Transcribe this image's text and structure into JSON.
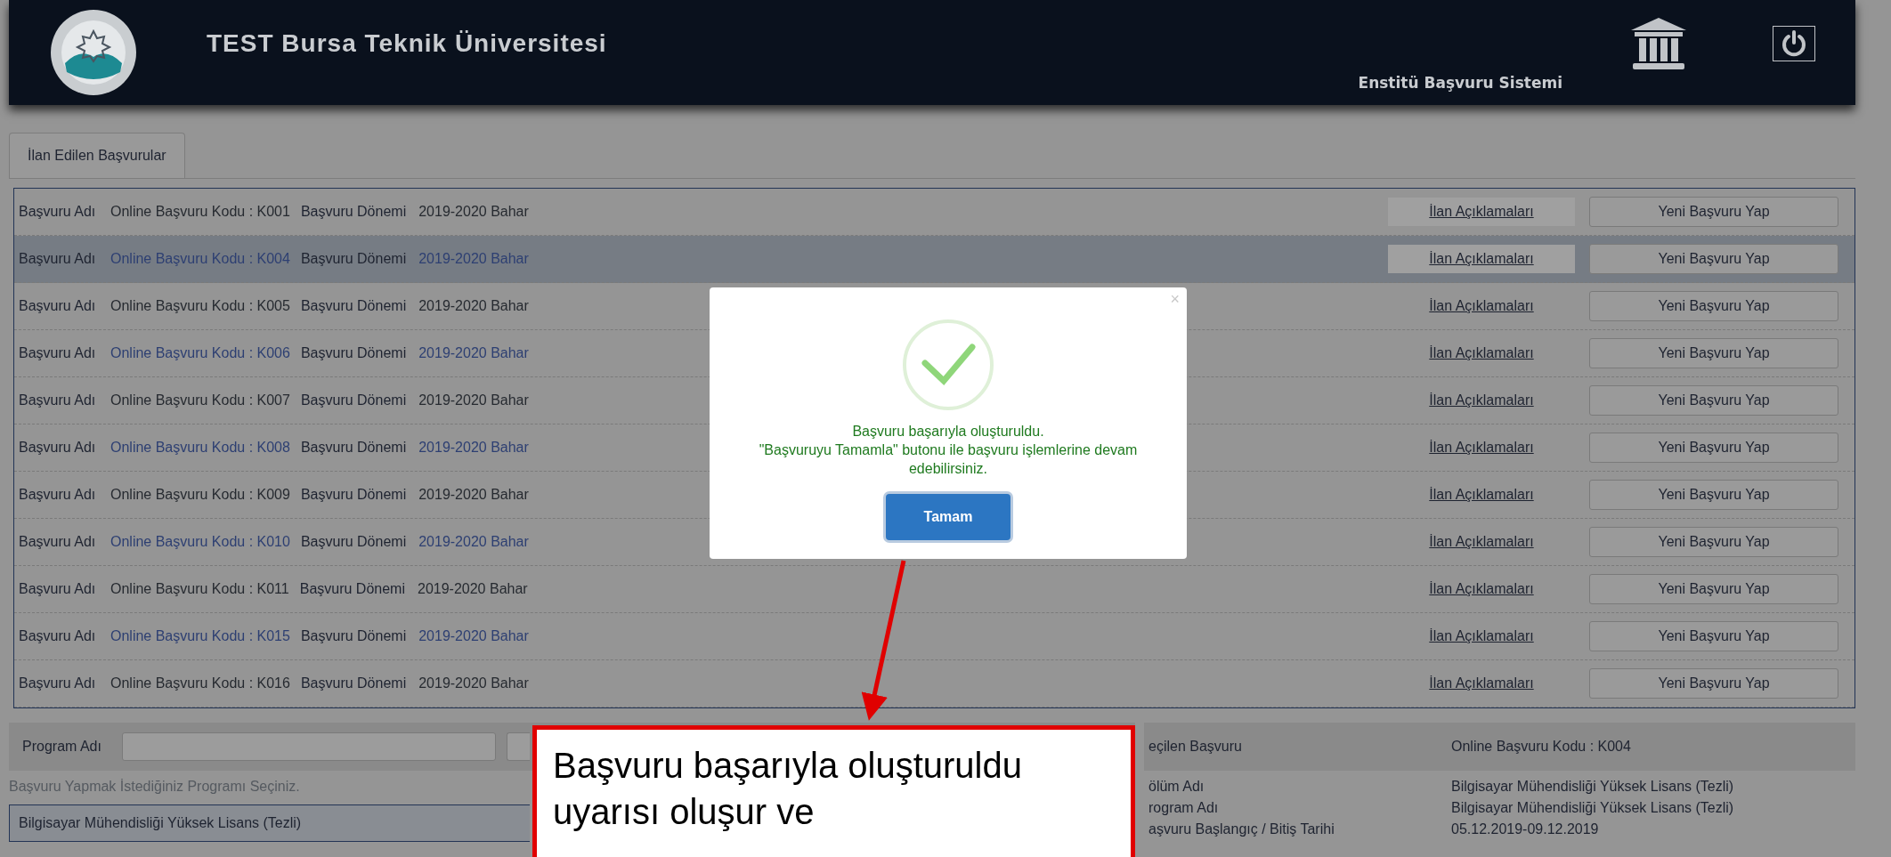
{
  "header": {
    "title": "TEST Bursa Teknik Üniversitesi",
    "subtitle": "Enstitü Başvuru Sistemi"
  },
  "tabs": [
    {
      "label": "İlan Edilen Başvurular",
      "selected": true
    }
  ],
  "rows": [
    {
      "name_label": "Başvuru Adı",
      "code": "Online Başvuru Kodu : K001",
      "period_label": "Başvuru Dönemi",
      "period": "2019-2020 Bahar",
      "link": "İlan Açıklamaları",
      "button": "Yeni Başvuru Yap",
      "selected": false
    },
    {
      "name_label": "Başvuru Adı",
      "code": "Online Başvuru Kodu : K004",
      "period_label": "Başvuru Dönemi",
      "period": "2019-2020 Bahar",
      "link": "İlan Açıklamaları",
      "button": "Yeni Başvuru Yap",
      "selected": true
    },
    {
      "name_label": "Başvuru Adı",
      "code": "Online Başvuru Kodu : K005",
      "period_label": "Başvuru Dönemi",
      "period": "2019-2020 Bahar",
      "link": "İlan Açıklamaları",
      "button": "Yeni Başvuru Yap",
      "selected": false
    },
    {
      "name_label": "Başvuru Adı",
      "code": "Online Başvuru Kodu : K006",
      "period_label": "Başvuru Dönemi",
      "period": "2019-2020 Bahar",
      "link": "İlan Açıklamaları",
      "button": "Yeni Başvuru Yap",
      "selected": false
    },
    {
      "name_label": "Başvuru Adı",
      "code": "Online Başvuru Kodu : K007",
      "period_label": "Başvuru Dönemi",
      "period": "2019-2020 Bahar",
      "link": "İlan Açıklamaları",
      "button": "Yeni Başvuru Yap",
      "selected": false
    },
    {
      "name_label": "Başvuru Adı",
      "code": "Online Başvuru Kodu : K008",
      "period_label": "Başvuru Dönemi",
      "period": "2019-2020 Bahar",
      "link": "İlan Açıklamaları",
      "button": "Yeni Başvuru Yap",
      "selected": false
    },
    {
      "name_label": "Başvuru Adı",
      "code": "Online Başvuru Kodu : K009",
      "period_label": "Başvuru Dönemi",
      "period": "2019-2020 Bahar",
      "link": "İlan Açıklamaları",
      "button": "Yeni Başvuru Yap",
      "selected": false
    },
    {
      "name_label": "Başvuru Adı",
      "code": "Online Başvuru Kodu : K010",
      "period_label": "Başvuru Dönemi",
      "period": "2019-2020 Bahar",
      "link": "İlan Açıklamaları",
      "button": "Yeni Başvuru Yap",
      "selected": false
    },
    {
      "name_label": "Başvuru Adı",
      "code": "Online Başvuru Kodu : K011",
      "period_label": "Başvuru Dönemi",
      "period": "2019-2020 Bahar",
      "link": "İlan Açıklamaları",
      "button": "Yeni Başvuru Yap",
      "selected": false
    },
    {
      "name_label": "Başvuru Adı",
      "code": "Online Başvuru Kodu : K015",
      "period_label": "Başvuru Dönemi",
      "period": "2019-2020 Bahar",
      "link": "İlan Açıklamaları",
      "button": "Yeni Başvuru Yap",
      "selected": false
    },
    {
      "name_label": "Başvuru Adı",
      "code": "Online Başvuru Kodu : K016",
      "period_label": "Başvuru Dönemi",
      "period": "2019-2020 Bahar",
      "link": "İlan Açıklamaları",
      "button": "Yeni Başvuru Yap",
      "selected": false
    }
  ],
  "program_search": {
    "label": "Program Adı",
    "hint": "Başvuru Yapmak İstediğiniz Programı Seçiniz.",
    "programs": [
      {
        "label": "Bilgisayar Mühendisliği Yüksek Lisans (Tezli)",
        "selected": true
      }
    ]
  },
  "selected_panel": {
    "title": "eçilen Başvuru",
    "code": "Online Başvuru Kodu : K004",
    "fields": [
      {
        "label": "ölüm Adı",
        "value": "Bilgisayar Mühendisliği Yüksek Lisans (Tezli)"
      },
      {
        "label": "rogram Adı",
        "value": "Bilgisayar Mühendisliği Yüksek Lisans (Tezli)"
      },
      {
        "label": "aşvuru Başlangıç / Bitiş Tarihi",
        "value": "05.12.2019-09.12.2019"
      }
    ]
  },
  "dialog": {
    "close": "×",
    "message": "Başvuru başarıyla oluşturuldu.\n\"Başvuruyu Tamamla\" butonu ile başvuru işlemlerine devam edebilirsiniz.",
    "button": "Tamam"
  },
  "callout": {
    "lines": [
      "Başvuru başarıyla oluşturuldu",
      "uyarısı oluşur ve"
    ]
  }
}
